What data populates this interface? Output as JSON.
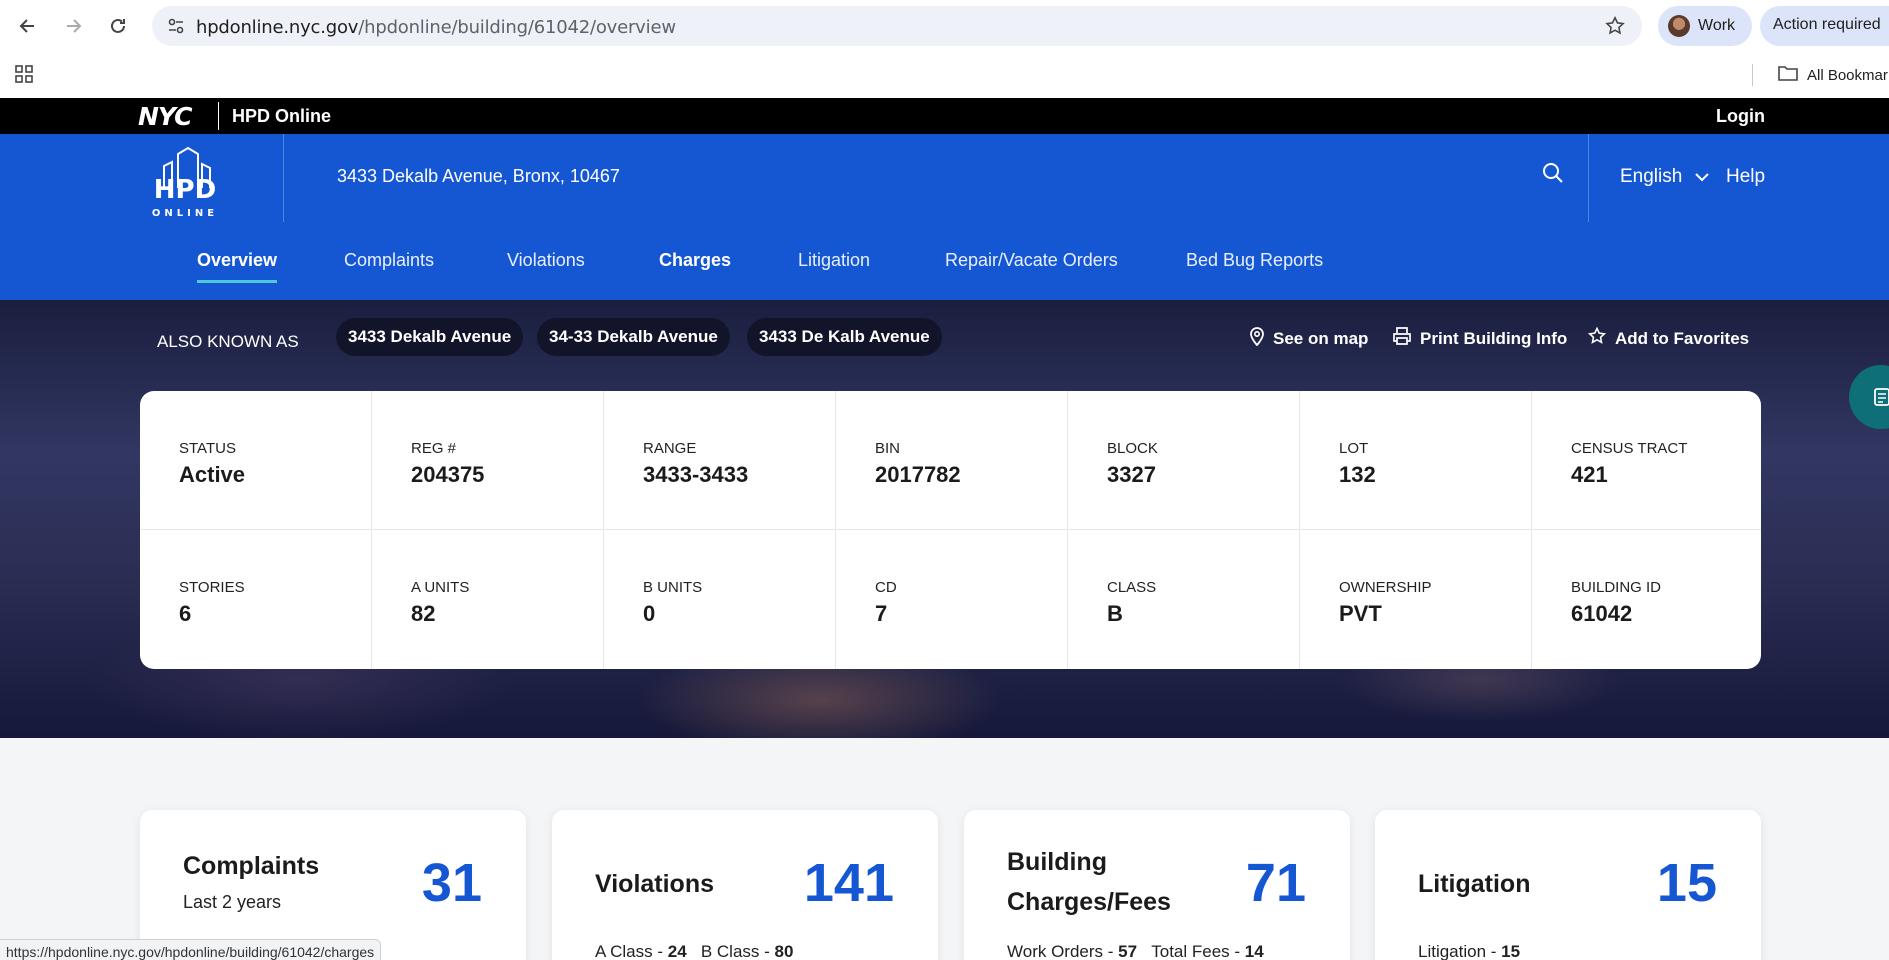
{
  "browser": {
    "url_host": "hpdonline.nyc.gov",
    "url_path": "/hpdonline/building/61042/overview",
    "profile_label": "Work",
    "action_label": "Action required",
    "bookmarks_label": "All Bookmar",
    "status_url": "https://hpdonline.nyc.gov/hpdonline/building/61042/charges",
    "icons": [
      "back-icon",
      "forward-icon",
      "reload-icon",
      "site-settings-icon",
      "bookmark-star-icon",
      "apps-grid-icon",
      "folder-icon"
    ]
  },
  "top_bar": {
    "nyc_logo": "NYC",
    "site_title": "HPD Online",
    "login_label": "Login"
  },
  "header": {
    "logo_text": "HPD",
    "logo_sub": "ONLINE",
    "address": "3433 Dekalb Avenue, Bronx, 10467",
    "language": "English",
    "help_label": "Help",
    "accent_color": "#1557d3"
  },
  "tabs": [
    {
      "label": "Overview",
      "active": true
    },
    {
      "label": "Complaints"
    },
    {
      "label": "Violations"
    },
    {
      "label": "Charges"
    },
    {
      "label": "Litigation"
    },
    {
      "label": "Repair/Vacate Orders"
    },
    {
      "label": "Bed Bug Reports"
    }
  ],
  "aka": {
    "label": "ALSO KNOWN AS",
    "names": [
      "3433 Dekalb Avenue",
      "34-33 Dekalb Avenue",
      "3433 De Kalb Avenue"
    ]
  },
  "actions": {
    "map": "See on map",
    "print": "Print Building Info",
    "favorite": "Add to Favorites"
  },
  "building_info": [
    {
      "label": "STATUS",
      "value": "Active"
    },
    {
      "label": "REG #",
      "value": "204375"
    },
    {
      "label": "RANGE",
      "value": "3433-3433"
    },
    {
      "label": "BIN",
      "value": "2017782"
    },
    {
      "label": "BLOCK",
      "value": "3327"
    },
    {
      "label": "LOT",
      "value": "132"
    },
    {
      "label": "CENSUS TRACT",
      "value": "421"
    },
    {
      "label": "STORIES",
      "value": "6"
    },
    {
      "label": "A UNITS",
      "value": "82"
    },
    {
      "label": "B UNITS",
      "value": "0"
    },
    {
      "label": "CD",
      "value": "7"
    },
    {
      "label": "CLASS",
      "value": "B"
    },
    {
      "label": "OWNERSHIP",
      "value": "PVT"
    },
    {
      "label": "BUILDING ID",
      "value": "61042"
    }
  ],
  "summary": {
    "complaints": {
      "title": "Complaints",
      "subtitle": "Last 2 years",
      "count": "31"
    },
    "violations": {
      "title": "Violations",
      "count": "141",
      "a_label": "A Class - ",
      "a_value": "24",
      "b_label": "B Class - ",
      "b_value": "80"
    },
    "charges": {
      "title_line1": "Building",
      "title_line2": "Charges/Fees",
      "count": "71",
      "wo_label": "Work Orders - ",
      "wo_value": "57",
      "tf_label": "Total Fees - ",
      "tf_value": "14"
    },
    "litigation": {
      "title": "Litigation",
      "count": "15",
      "lit_label": "Litigation - ",
      "lit_value": "15"
    }
  }
}
